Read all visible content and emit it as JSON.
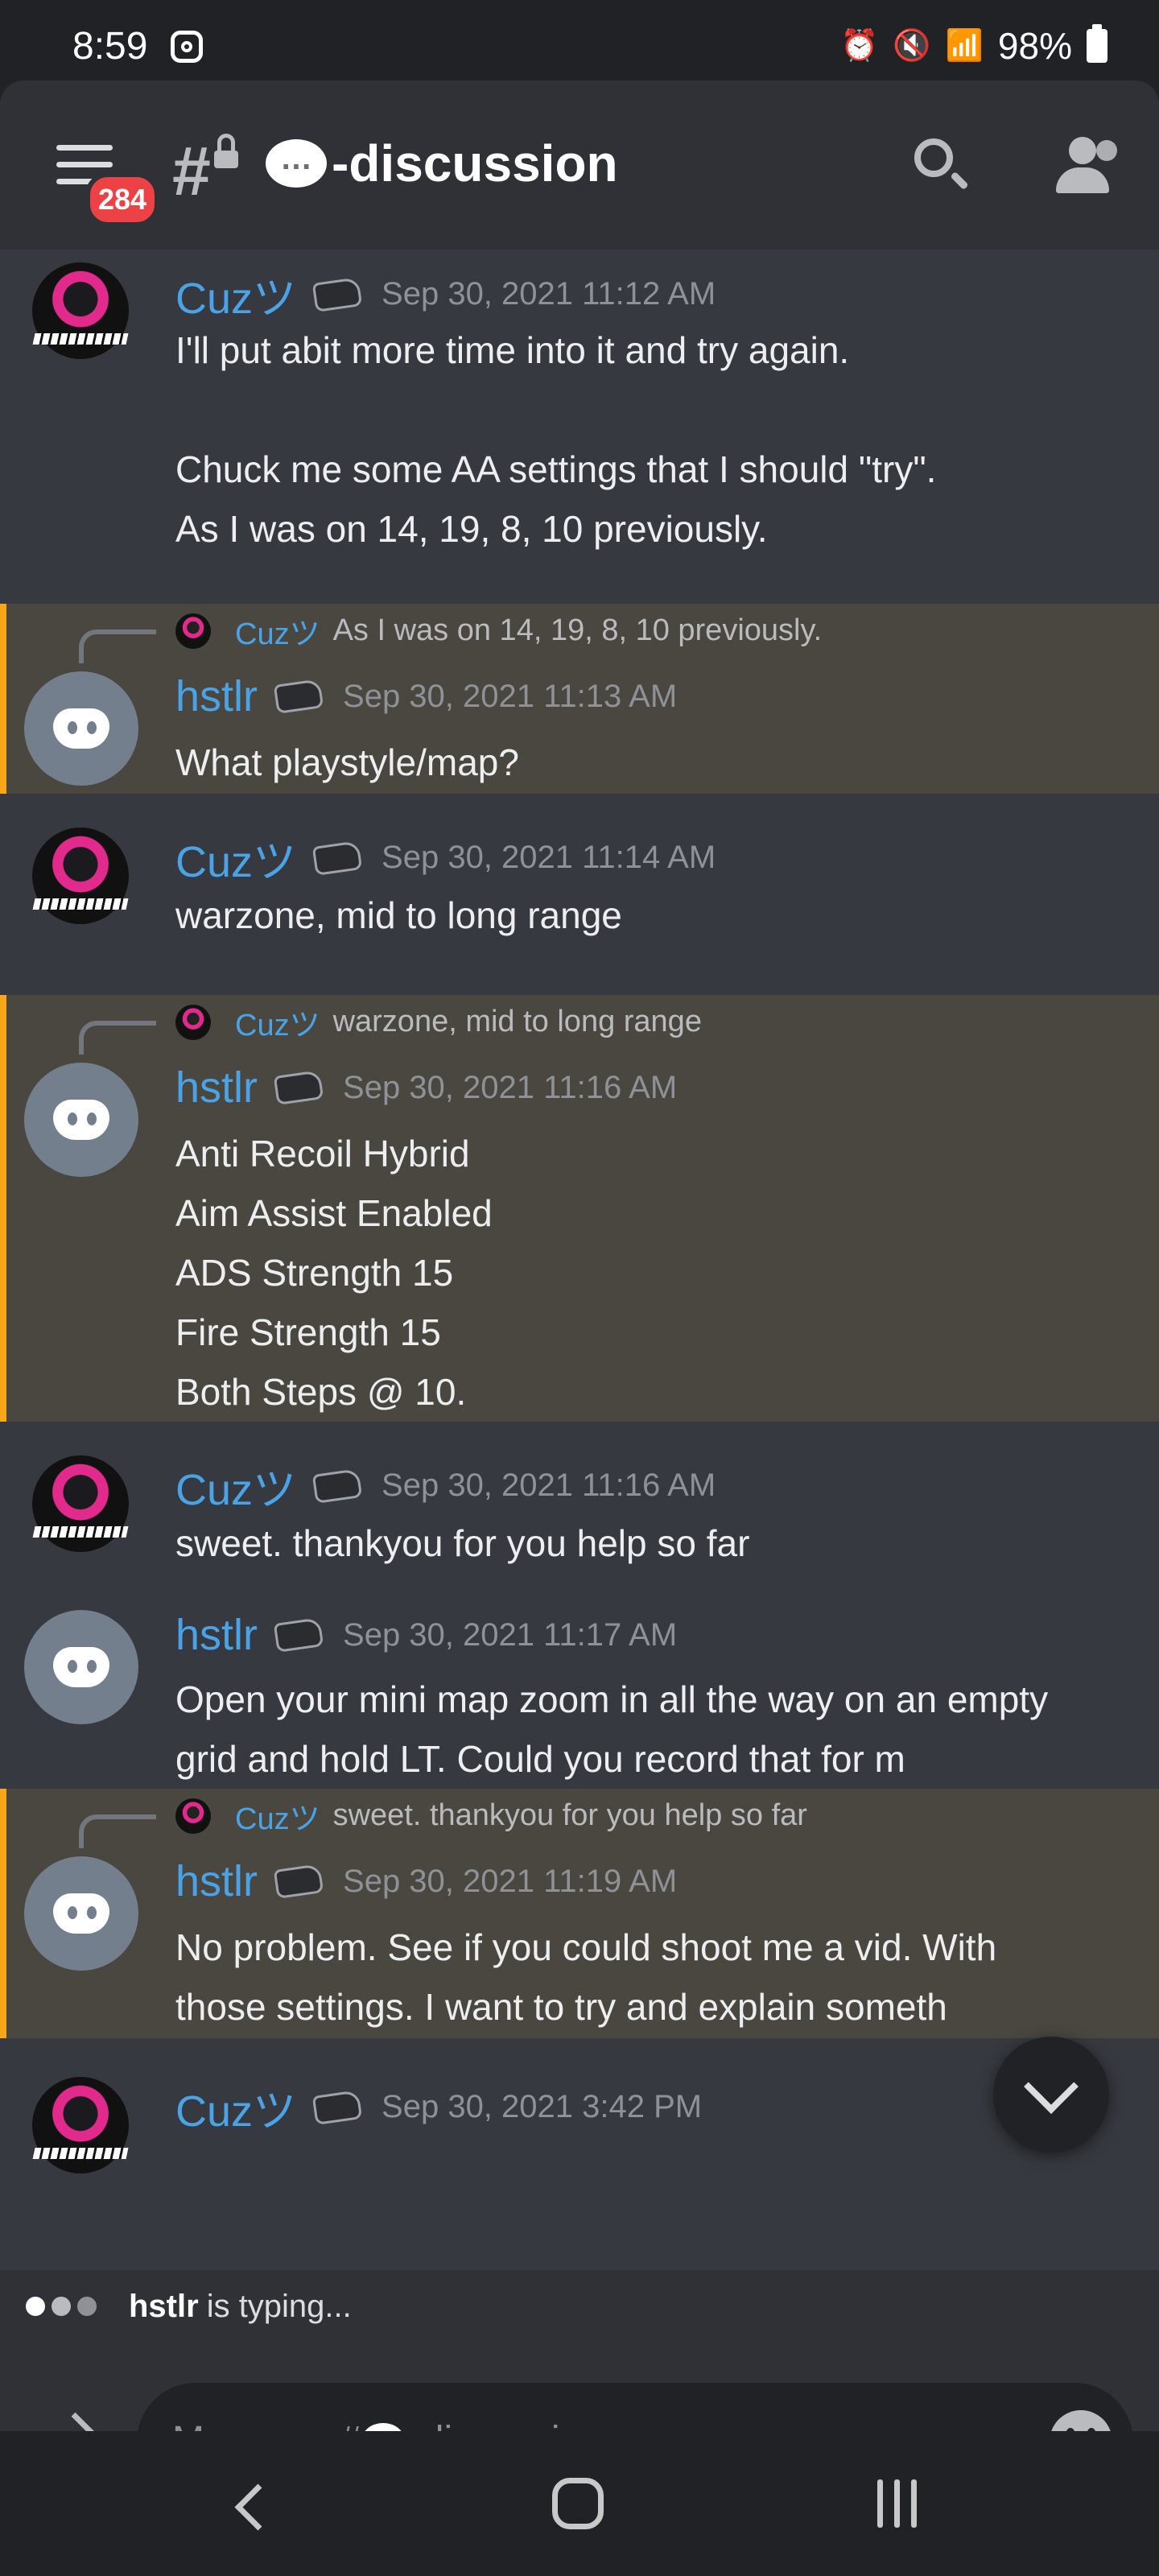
{
  "status_bar": {
    "time": "8:59",
    "battery": "98%",
    "network": "LTE1"
  },
  "header": {
    "unread_count": "284",
    "channel_name": "-discussion"
  },
  "messages": [
    {
      "author": "Cuzツ",
      "timestamp": "Sep 30, 2021 11:12 AM",
      "lines": [
        "I'll put abit more time into it and try again.",
        "",
        "Chuck me some AA settings that I should \"try\".",
        "As I was on 14, 19, 8, 10 previously."
      ]
    },
    {
      "author": "hstlr",
      "timestamp": "Sep 30, 2021 11:13 AM",
      "reply_author": "Cuzツ",
      "reply_text": "As I was on 14, 19, 8, 10 previously.",
      "lines": [
        "What playstyle/map?"
      ]
    },
    {
      "author": "Cuzツ",
      "timestamp": "Sep 30, 2021 11:14 AM",
      "lines": [
        "warzone, mid to long range"
      ]
    },
    {
      "author": "hstlr",
      "timestamp": "Sep 30, 2021 11:16 AM",
      "reply_author": "Cuzツ",
      "reply_text": "warzone, mid to long range",
      "lines": [
        "Anti Recoil Hybrid",
        "Aim Assist Enabled",
        "ADS Strength 15",
        "Fire Strength 15",
        "Both Steps @ 10."
      ]
    },
    {
      "author": "Cuzツ",
      "timestamp": "Sep 30, 2021 11:16 AM",
      "lines": [
        "sweet. thankyou for you help so far"
      ]
    },
    {
      "author": "hstlr",
      "timestamp": "Sep 30, 2021 11:17 AM",
      "lines": [
        "Open your mini map zoom in all the way on an empty",
        "grid and hold LT. Could you record that for m"
      ]
    },
    {
      "author": "hstlr",
      "timestamp": "Sep 30, 2021 11:19 AM",
      "reply_author": "Cuzツ",
      "reply_text": "sweet. thankyou for you help so far",
      "lines": [
        "No problem. See if you could shoot me a vid. With",
        "those settings. I want to try and explain someth"
      ]
    },
    {
      "author": "Cuzツ",
      "timestamp": "Sep 30, 2021 3:42 PM",
      "lines": []
    }
  ],
  "typing": {
    "user": "hstlr",
    "text": "is typing..."
  },
  "composer": {
    "placeholder_prefix": "Message #",
    "placeholder_suffix": "-discussion"
  }
}
